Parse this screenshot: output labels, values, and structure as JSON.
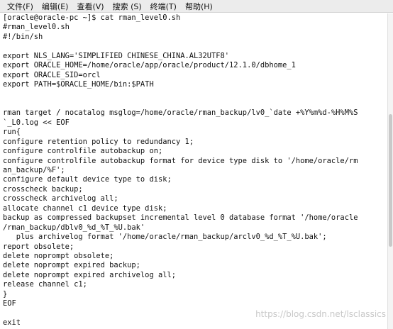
{
  "menu": {
    "file": "文件(F)",
    "edit": "编辑(E)",
    "view": "查看(V)",
    "search": "搜索 (S)",
    "terminal": "终端(T)",
    "help": "帮助(H)"
  },
  "terminal": {
    "lines": [
      "[oracle@oracle-pc ~]$ cat rman_level0.sh",
      "#rman_level0.sh",
      "#!/bin/sh",
      "",
      "export NLS_LANG='SIMPLIFIED CHINESE_CHINA.AL32UTF8'",
      "export ORACLE_HOME=/home/oracle/app/oracle/product/12.1.0/dbhome_1",
      "export ORACLE_SID=orcl",
      "export PATH=$ORACLE_HOME/bin:$PATH",
      "",
      "",
      "rman target / nocatalog msglog=/home/oracle/rman_backup/lv0_`date +%Y%m%d-%H%M%S",
      "`_L0.log << EOF",
      "run{",
      "configure retention policy to redundancy 1;",
      "configure controlfile autobackup on;",
      "configure controlfile autobackup format for device type disk to '/home/oracle/rm",
      "an_backup/%F';",
      "configure default device type to disk;",
      "crosscheck backup;",
      "crosscheck archivelog all;",
      "allocate channel c1 device type disk;",
      "backup as compressed backupset incremental level 0 database format '/home/oracle",
      "/rman_backup/dblv0_%d_%T_%U.bak'",
      "   plus archivelog format '/home/oracle/rman_backup/arclv0_%d_%T_%U.bak';",
      "report obsolete;",
      "delete noprompt obsolete;",
      "delete noprompt expired backup;",
      "delete noprompt expired archivelog all;",
      "release channel c1;",
      "}",
      "EOF",
      "",
      "exit"
    ],
    "scroll_position": 0.55
  },
  "watermark": "https://blog.csdn.net/lsclassics"
}
